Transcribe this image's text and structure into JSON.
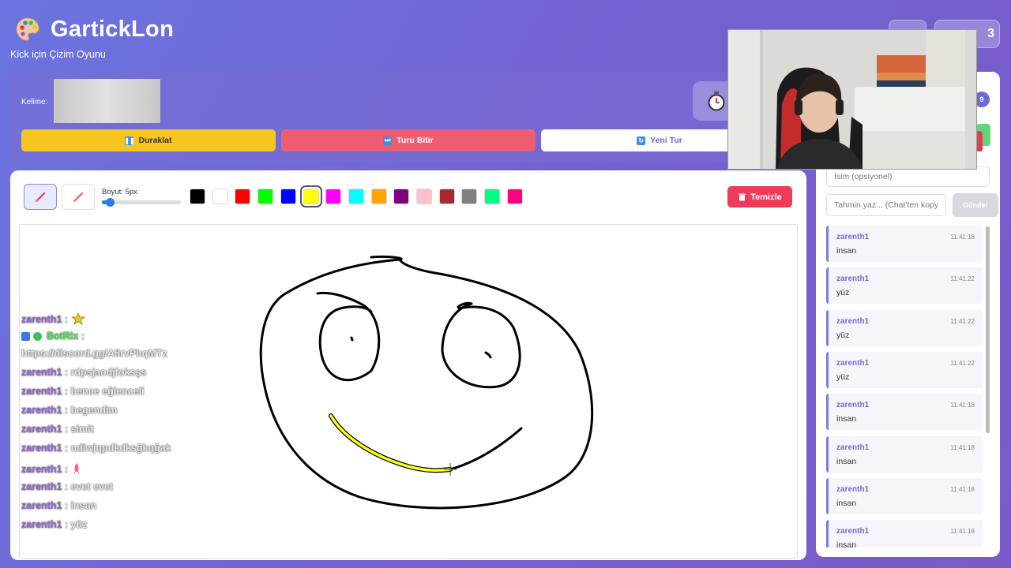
{
  "app": {
    "title": "GartickLon",
    "subtitle": "Kick için Çizim Oyunu",
    "logo_icon": "palette-icon",
    "top_right_value": "3"
  },
  "game": {
    "word_label": "Kelime:",
    "timer_icon": "stopwatch-icon",
    "controls": {
      "pause_label": "Duraklat",
      "end_round_label": "Turu Bitir",
      "new_round_label": "Yeni Tur"
    }
  },
  "toolbar": {
    "size_label": "Boyut: 5px",
    "size_value": 5,
    "clear_label": "Temizle",
    "selected_color": "#ffff00",
    "colors": [
      "#000000",
      "#ffffff",
      "#ff0000",
      "#00ff00",
      "#0000ff",
      "#ffff00",
      "#ff00ff",
      "#00ffff",
      "#ffa500",
      "#800080",
      "#ffc0cb",
      "#a52a2a",
      "#808080",
      "#00ff80",
      "#ff0080"
    ]
  },
  "overlay_chat": [
    {
      "user": "zarenth1",
      "text": " : ",
      "emote": "star-emote"
    },
    {
      "user": "BotRix",
      "text": " :",
      "bot": true
    },
    {
      "user": "",
      "text": "https://discord.gg/A5rvPhqMTz"
    },
    {
      "user": "zarenth1",
      "text": " : rdpsjaodjfoksşs"
    },
    {
      "user": "zarenth1",
      "text": " : bence eğlenceli"
    },
    {
      "user": "zarenth1",
      "text": " : begendim"
    },
    {
      "user": "zarenth1",
      "text": " : simit"
    },
    {
      "user": "zarenth1",
      "text": " : ndlwjqpdkdksğkqğak"
    },
    {
      "user": "zarenth1",
      "text": " : ",
      "emote": "rocket-emote"
    },
    {
      "user": "zarenth1",
      "text": " : evet evet"
    },
    {
      "user": "zarenth1",
      "text": " : insan"
    },
    {
      "user": "zarenth1",
      "text": " : yüz"
    }
  ],
  "chat": {
    "badge_count": "9",
    "name_placeholder": "İsim (opsiyonel)",
    "guess_placeholder": "Tahmin yaz... (Chat'ten kopy",
    "send_label": "Gönder",
    "messages": [
      {
        "user": "zarenth1",
        "time": "11:41:18",
        "text": "insan"
      },
      {
        "user": "zarenth1",
        "time": "11:41:22",
        "text": "yüz"
      },
      {
        "user": "zarenth1",
        "time": "11:41:22",
        "text": "yüz"
      },
      {
        "user": "zarenth1",
        "time": "11:41:22",
        "text": "yüz"
      },
      {
        "user": "zarenth1",
        "time": "11:41:18",
        "text": "insan"
      },
      {
        "user": "zarenth1",
        "time": "11:41:18",
        "text": "insan"
      },
      {
        "user": "zarenth1",
        "time": "11:41:18",
        "text": "insan"
      },
      {
        "user": "zarenth1",
        "time": "11:41:18",
        "text": "insan"
      }
    ]
  }
}
